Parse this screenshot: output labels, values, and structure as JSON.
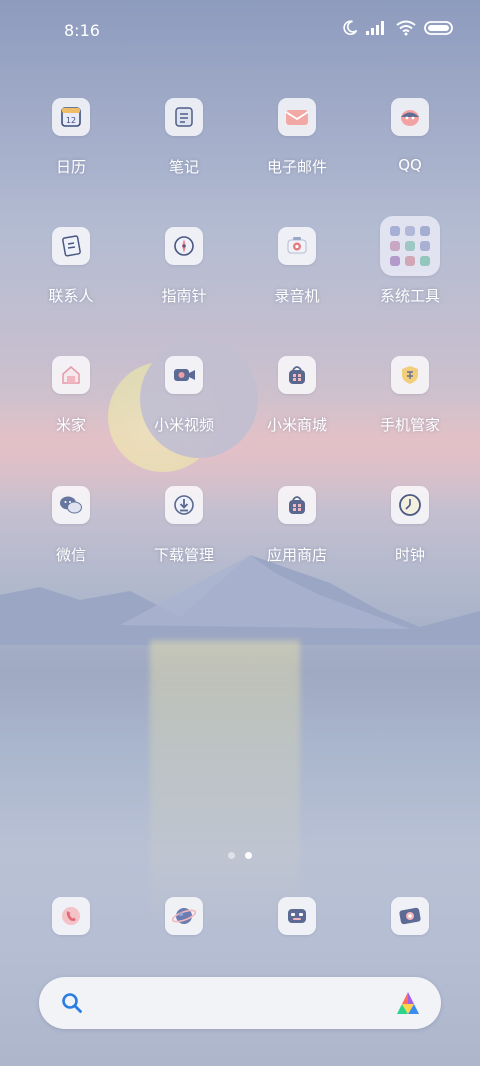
{
  "status_bar": {
    "time": "8:16",
    "icons": [
      "moon-icon",
      "signal-icon",
      "wifi-icon",
      "battery-icon"
    ]
  },
  "apps": [
    {
      "label": "日历",
      "icon": "calendar-icon",
      "icon_text": "12"
    },
    {
      "label": "笔记",
      "icon": "notes-icon"
    },
    {
      "label": "电子邮件",
      "icon": "email-icon"
    },
    {
      "label": "QQ",
      "icon": "qq-icon"
    },
    {
      "label": "联系人",
      "icon": "contacts-icon"
    },
    {
      "label": "指南针",
      "icon": "compass-icon"
    },
    {
      "label": "录音机",
      "icon": "recorder-icon"
    },
    {
      "label": "系统工具",
      "icon": "folder-icon"
    },
    {
      "label": "米家",
      "icon": "mijia-icon"
    },
    {
      "label": "小米视频",
      "icon": "video-icon"
    },
    {
      "label": "小米商城",
      "icon": "mall-icon"
    },
    {
      "label": "手机管家",
      "icon": "security-icon"
    },
    {
      "label": "微信",
      "icon": "wechat-icon"
    },
    {
      "label": "下载管理",
      "icon": "download-icon"
    },
    {
      "label": "应用商店",
      "icon": "app-store-icon"
    },
    {
      "label": "时钟",
      "icon": "clock-icon"
    }
  ],
  "dock": [
    {
      "icon": "phone-icon"
    },
    {
      "icon": "browser-icon"
    },
    {
      "icon": "assistant-bot-icon"
    },
    {
      "icon": "camera-icon"
    }
  ],
  "page_indicator": {
    "pages": 2,
    "active": 2
  },
  "search": {
    "icons": [
      "search-icon",
      "assistant-icon"
    ]
  },
  "colors": {
    "label_text": "#ffffff",
    "icon_tile": "#f4f5fb",
    "accent_blue": "#2a7de1",
    "search_bg": "#f2f3f7"
  }
}
